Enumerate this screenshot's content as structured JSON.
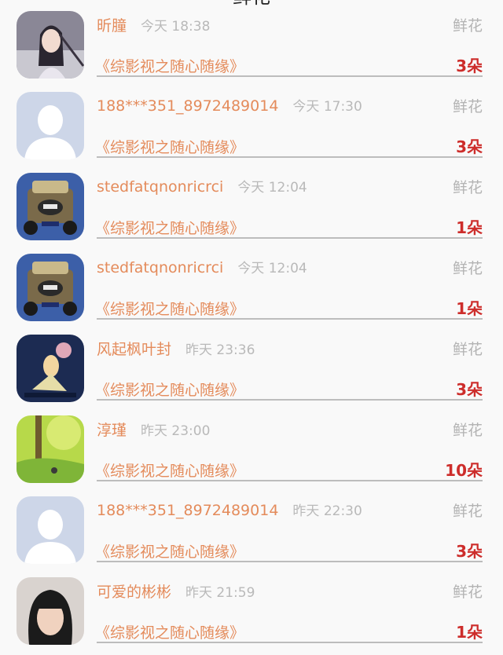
{
  "header": {
    "title_partial": "鲜花"
  },
  "records": [
    {
      "user": "昕朣",
      "time": "今天 18:38",
      "gift": "鲜花",
      "book": "《综影视之随心随缘》",
      "count": "3朵",
      "avatar": "girl-portrait"
    },
    {
      "user": "188***351_8972489014",
      "time": "今天 17:30",
      "gift": "鲜花",
      "book": "《综影视之随心随缘》",
      "count": "3朵",
      "avatar": "default-person"
    },
    {
      "user": "stedfatqnonricrci",
      "time": "今天 12:04",
      "gift": "鲜花",
      "book": "《综影视之随心随缘》",
      "count": "1朵",
      "avatar": "toy-car"
    },
    {
      "user": "stedfatqnonricrci",
      "time": "今天 12:04",
      "gift": "鲜花",
      "book": "《综影视之随心随缘》",
      "count": "1朵",
      "avatar": "toy-car"
    },
    {
      "user": "风起枫叶封",
      "time": "昨天 23:36",
      "gift": "鲜花",
      "book": "《综影视之随心随缘》",
      "count": "3朵",
      "avatar": "illustrated-girl"
    },
    {
      "user": "淳瑾",
      "time": "昨天 23:00",
      "gift": "鲜花",
      "book": "《综影视之随心随缘》",
      "count": "10朵",
      "avatar": "forest-scene"
    },
    {
      "user": "188***351_8972489014",
      "time": "昨天 22:30",
      "gift": "鲜花",
      "book": "《综影视之随心随缘》",
      "count": "3朵",
      "avatar": "default-person"
    },
    {
      "user": "可爱的彬彬",
      "time": "昨天 21:59",
      "gift": "鲜花",
      "book": "《综影视之随心随缘》",
      "count": "1朵",
      "avatar": "selfie-photo"
    }
  ]
}
